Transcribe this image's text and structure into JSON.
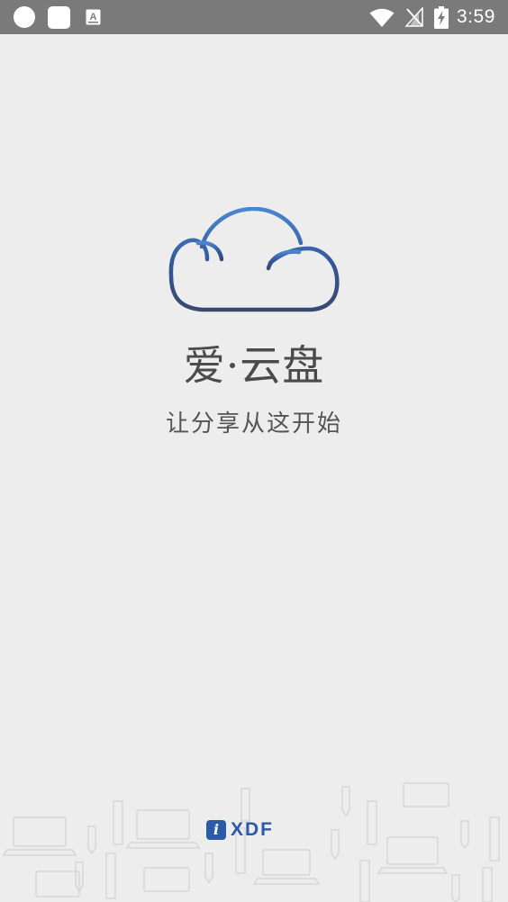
{
  "status_bar": {
    "time": "3:59",
    "icons": [
      "notification-circle-icon",
      "notification-square-icon",
      "keyboard-a-icon",
      "wifi-icon",
      "no-signal-icon",
      "battery-charging-icon"
    ]
  },
  "splash": {
    "app_name": "爱·云盘",
    "tagline": "让分享从这开始",
    "logo_icon": "cloud-icon"
  },
  "footer": {
    "brand_mark": "i",
    "brand_text": "XDF",
    "pattern_icons": [
      "laptop-icon",
      "pencil-icon",
      "ruler-icon"
    ]
  },
  "colors": {
    "background": "#ededed",
    "status_bar": "#7a7a7a",
    "cloud_gradient_top": "#4a86cf",
    "cloud_gradient_bottom": "#3a4a6e",
    "brand_blue": "#2a5aa8"
  }
}
